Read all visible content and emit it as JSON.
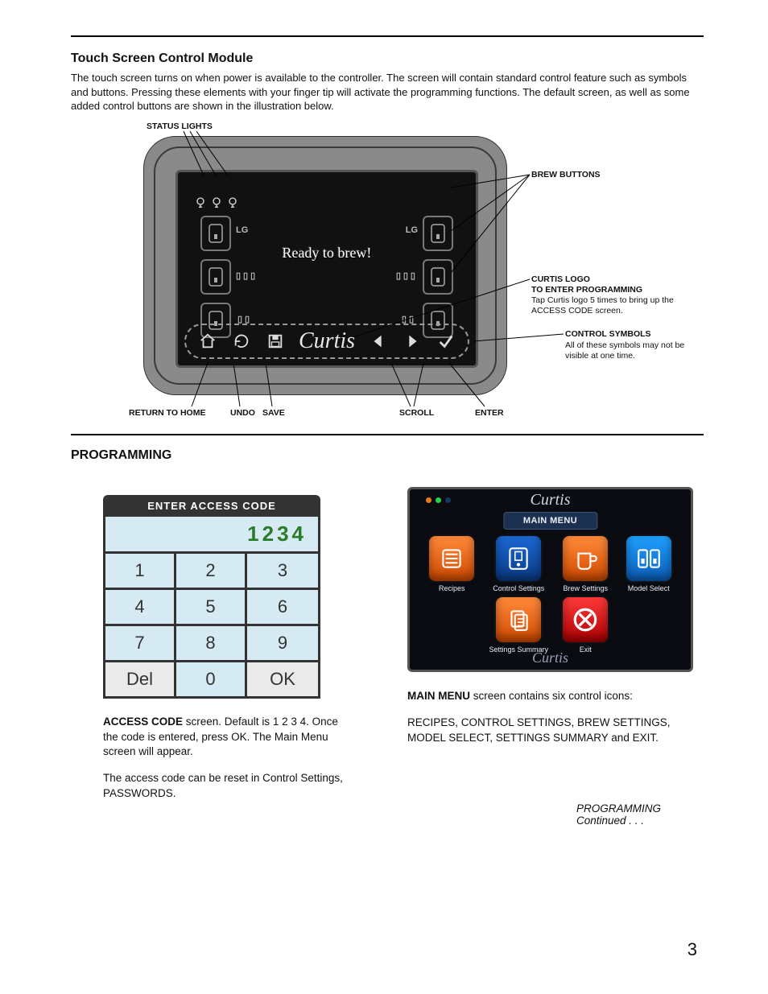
{
  "page_number": "3",
  "section1": {
    "title": "Touch Screen Control Module",
    "body": "The touch screen turns on when power is available to the controller. The screen will contain standard control feature such as symbols and buttons. Pressing these elements with your finger tip will activate the programming functions. The default screen, as well as some added control buttons are shown in the illustration below."
  },
  "touchscreen": {
    "status_msg": "Ready to brew!",
    "lg_label": "LG",
    "callouts": {
      "status_lights": "STATUS LIGHTS",
      "brew_buttons": "BREW BUTTONS",
      "curtis_logo_title": "CURTIS LOGO",
      "curtis_logo_sub1": "TO ENTER PROGRAMMING",
      "curtis_logo_sub2": "Tap Curtis logo 5 times to bring up the ACCESS CODE screen.",
      "control_symbols_title": "CONTROL SYMBOLS",
      "control_symbols_sub": "All of these symbols may not be visible at one time.",
      "return_home": "RETURN TO HOME",
      "undo": "UNDO",
      "save": "SAVE",
      "scroll": "SCROLL",
      "enter": "ENTER"
    },
    "logo_text": "Curtis"
  },
  "section2": {
    "title": "PROGRAMMING"
  },
  "keypad": {
    "title": "ENTER ACCESS CODE",
    "display": "1234",
    "keys": [
      "1",
      "2",
      "3",
      "4",
      "5",
      "6",
      "7",
      "8",
      "9",
      "Del",
      "0",
      "OK"
    ],
    "caption_strong": "ACCESS CODE",
    "caption1": " screen. Default is 1 2 3 4. Once the code is entered, press OK. The Main Menu screen will appear.",
    "caption2": "The access code can be reset in Control Settings, PASSWORDS."
  },
  "mainmenu": {
    "title": "MAIN MENU",
    "logo_text": "Curtis",
    "items": [
      {
        "name": "recipes",
        "label": "Recipes"
      },
      {
        "name": "control",
        "label": "Control Settings"
      },
      {
        "name": "brew",
        "label": "Brew Settings"
      },
      {
        "name": "model",
        "label": "Model Select"
      },
      {
        "name": "summary",
        "label": "Settings Summary"
      },
      {
        "name": "exit",
        "label": "Exit"
      }
    ],
    "caption_strong": "MAIN MENU",
    "caption1": " screen contains six control icons:",
    "caption2": "RECIPES, CONTROL SETTINGS, BREW SETTINGS, MODEL SELECT, SETTINGS SUMMARY and EXIT."
  },
  "continued": "PROGRAMMING Continued . . ."
}
